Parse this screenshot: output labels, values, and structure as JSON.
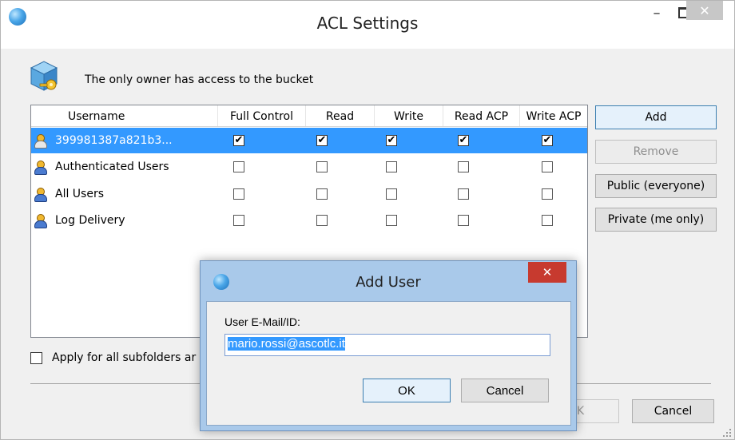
{
  "window": {
    "title": "ACL Settings",
    "minimize_glyph": "–",
    "close_glyph": "✕"
  },
  "header": {
    "text": "The only owner has access to the bucket"
  },
  "grid": {
    "columns": [
      "Username",
      "Full Control",
      "Read",
      "Write",
      "Read ACP",
      "Write ACP"
    ],
    "rows": [
      {
        "username": "399981387a821b3...",
        "full_control": true,
        "read": true,
        "write": true,
        "read_acp": true,
        "write_acp": true,
        "selected": true
      },
      {
        "username": "Authenticated Users",
        "full_control": false,
        "read": false,
        "write": false,
        "read_acp": false,
        "write_acp": false,
        "selected": false
      },
      {
        "username": "All Users",
        "full_control": false,
        "read": false,
        "write": false,
        "read_acp": false,
        "write_acp": false,
        "selected": false
      },
      {
        "username": "Log Delivery",
        "full_control": false,
        "read": false,
        "write": false,
        "read_acp": false,
        "write_acp": false,
        "selected": false
      }
    ]
  },
  "side_buttons": {
    "add": "Add",
    "remove": "Remove",
    "public": "Public (everyone)",
    "private": "Private (me only)"
  },
  "apply": {
    "label": "Apply for all subfolders ar",
    "checked": false
  },
  "footer": {
    "ok_partial": "K",
    "cancel": "Cancel"
  },
  "add_user_dialog": {
    "title": "Add User",
    "close_glyph": "✕",
    "field_label": "User E-Mail/ID:",
    "field_value": "mario.rossi@ascotlc.it",
    "ok": "OK",
    "cancel": "Cancel"
  },
  "colors": {
    "selection": "#3399ff",
    "dialog_frame": "#a9c9ea",
    "close_red": "#c73a2f"
  },
  "icons": {
    "app": "cloud-globe-icon",
    "header": "cube-key-icon",
    "user": "user-icon",
    "group": "group-icon",
    "check": "✔"
  }
}
